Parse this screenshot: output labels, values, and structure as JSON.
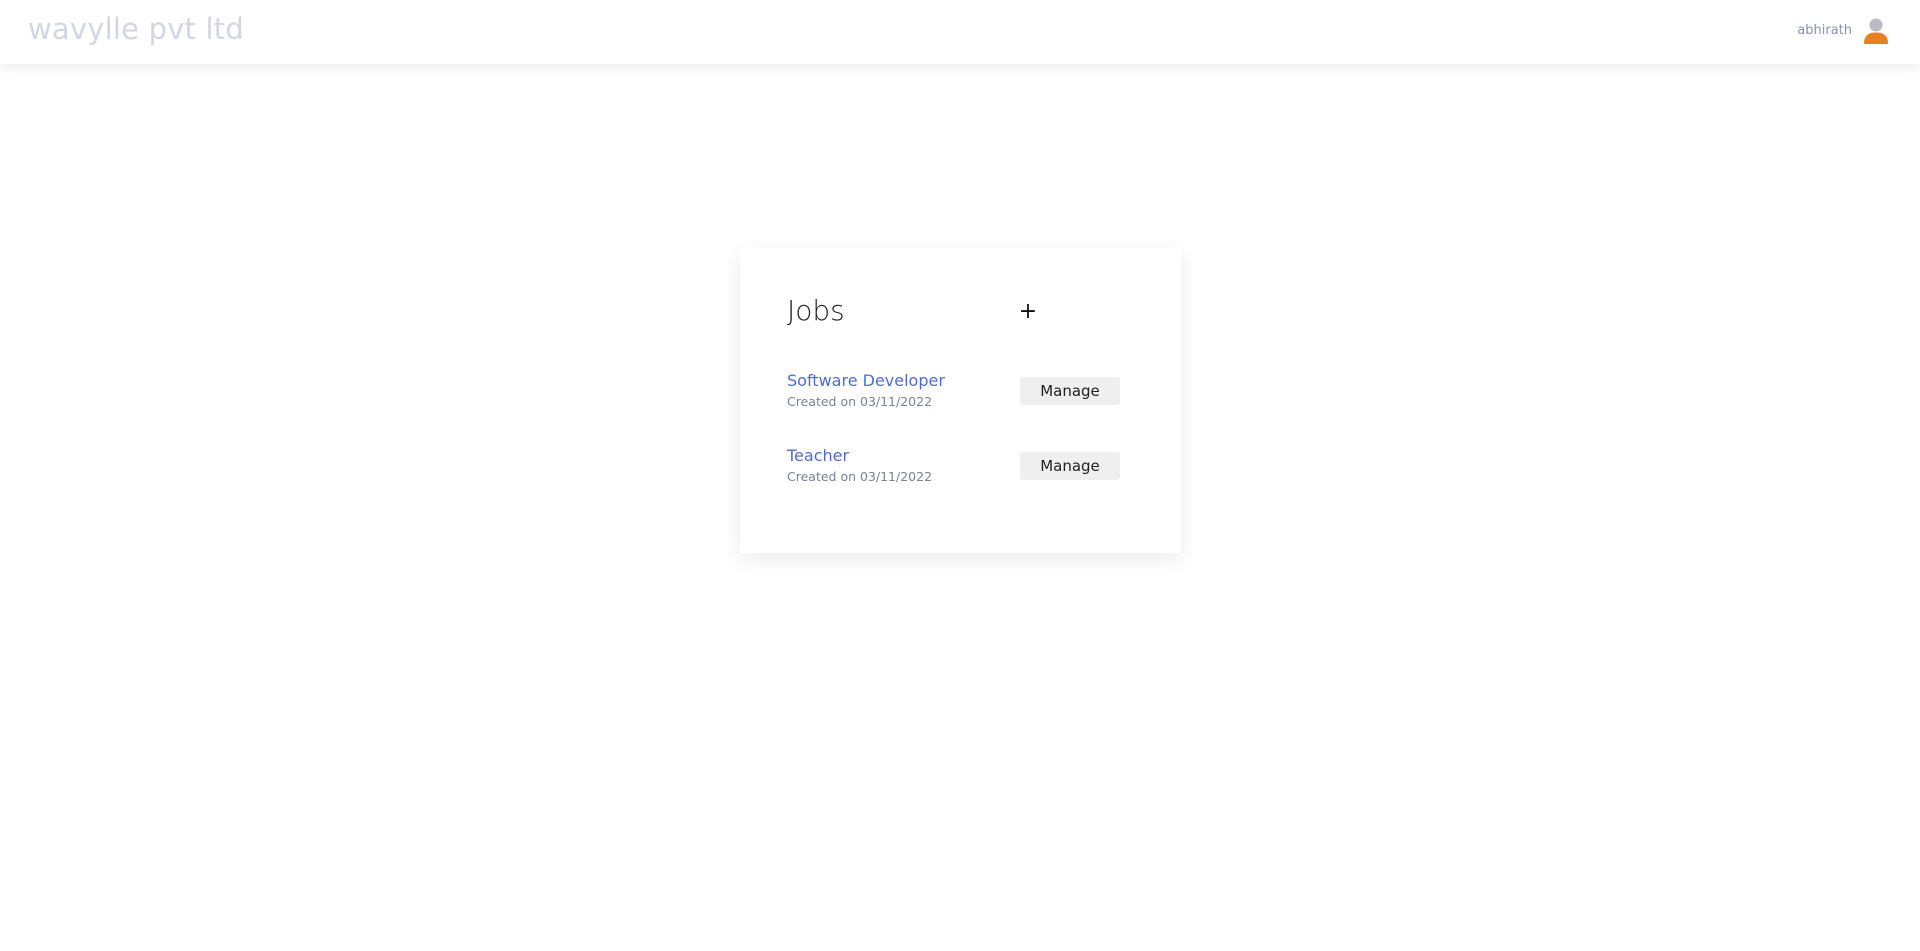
{
  "header": {
    "brand": "wavylle pvt ltd",
    "username": "abhirath",
    "avatar_icon": "user-avatar-icon"
  },
  "jobs_card": {
    "title": "Jobs",
    "add_label": "+",
    "items": [
      {
        "title": "Software Developer",
        "created": "Created on 03/11/2022",
        "manage_label": "Manage"
      },
      {
        "title": "Teacher",
        "created": "Created on 03/11/2022",
        "manage_label": "Manage"
      }
    ]
  },
  "colors": {
    "brand": "#d3d6e2",
    "link": "#4f6bd9",
    "avatar_body": "#e8801e",
    "avatar_head": "#b8bcc6",
    "button_bg": "#efefef"
  }
}
